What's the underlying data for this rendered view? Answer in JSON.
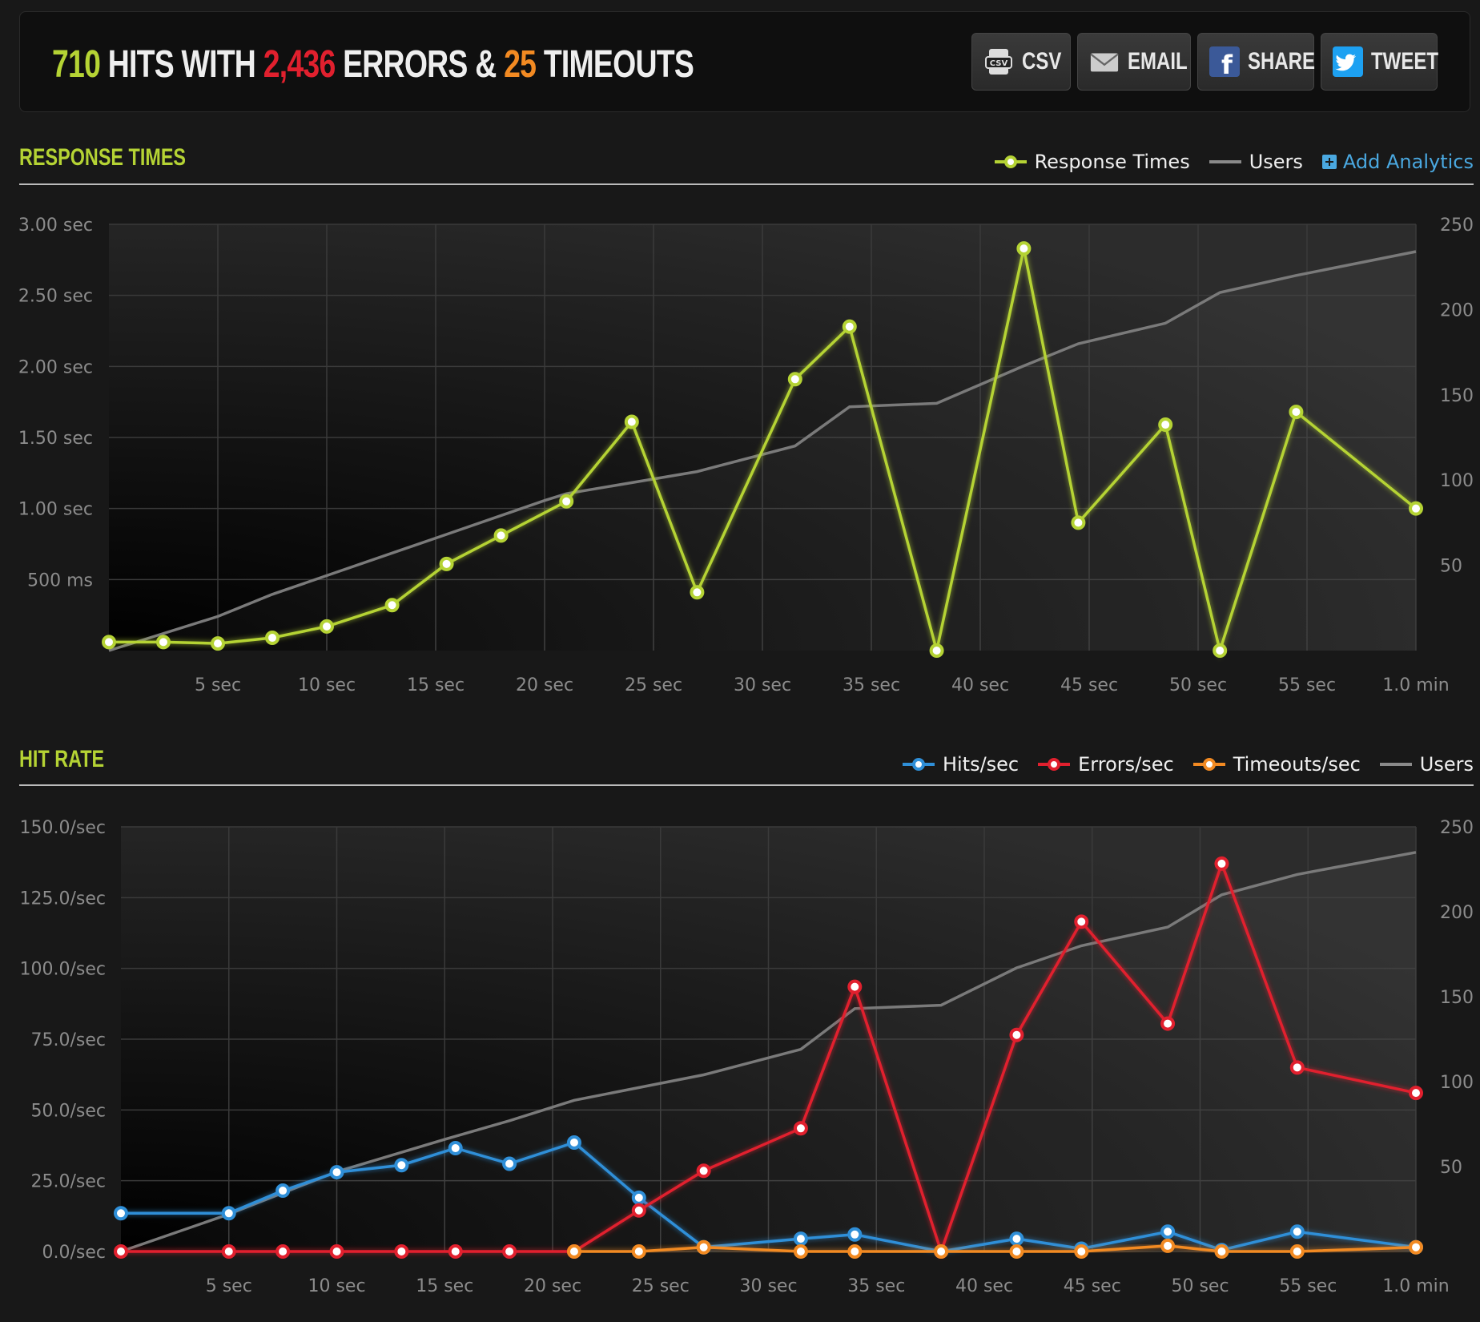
{
  "summary": {
    "hits_value": "710",
    "hits_text": " HITS WITH ",
    "errors_value": "2,436",
    "errors_text": " ERRORS & ",
    "timeouts_value": "25",
    "timeouts_text": " TIMEOUTS"
  },
  "buttons": {
    "csv": "CSV",
    "email": "EMAIL",
    "share": "SHARE",
    "tweet": "TWEET"
  },
  "response_section": {
    "title": "RESPONSE TIMES",
    "legend_response": "Response Times",
    "legend_users": "Users",
    "add_analytics": "Add Analytics"
  },
  "hitrate_section": {
    "title": "HIT RATE",
    "legend_hits": "Hits/sec",
    "legend_errors": "Errors/sec",
    "legend_timeouts": "Timeouts/sec",
    "legend_users": "Users"
  },
  "colors": {
    "response": "#b5d334",
    "users": "#7a7a7a",
    "hits": "#2f8fd8",
    "errors": "#e1202e",
    "timeouts": "#f28a22"
  },
  "chart_data": [
    {
      "type": "line",
      "title": "RESPONSE TIMES",
      "x_unit": "seconds",
      "xlim": [
        0,
        60
      ],
      "x_ticks": [
        5,
        10,
        15,
        20,
        25,
        30,
        35,
        40,
        45,
        50,
        55,
        60
      ],
      "x_tick_labels": [
        "5 sec",
        "10 sec",
        "15 sec",
        "20 sec",
        "25 sec",
        "30 sec",
        "35 sec",
        "40 sec",
        "45 sec",
        "50 sec",
        "55 sec",
        "1.0 min"
      ],
      "y_left_unit": "seconds",
      "ylim_left": [
        0,
        3.0
      ],
      "y_left_ticks": [
        0.5,
        1.0,
        1.5,
        2.0,
        2.5,
        3.0
      ],
      "y_left_tick_labels": [
        "500 ms",
        "1.00 sec",
        "1.50 sec",
        "2.00 sec",
        "2.50 sec",
        "3.00 sec"
      ],
      "ylim_right": [
        0,
        250
      ],
      "y_right_ticks": [
        50,
        100,
        150,
        200,
        250
      ],
      "y_right_tick_labels": [
        "50",
        "100",
        "150",
        "200",
        "250"
      ],
      "series": [
        {
          "name": "Response Times",
          "axis": "left",
          "color": "#b5d334",
          "markers": true,
          "x": [
            0,
            2.5,
            5,
            7.5,
            10,
            13,
            15.5,
            18,
            21,
            24,
            27,
            31.5,
            34,
            38,
            42,
            44.5,
            48.5,
            51,
            54.5,
            60
          ],
          "y": [
            0.06,
            0.06,
            0.05,
            0.09,
            0.17,
            0.32,
            0.61,
            0.81,
            1.05,
            1.61,
            0.41,
            1.91,
            2.28,
            0.0,
            2.83,
            0.9,
            1.59,
            0.0,
            1.68,
            1.0
          ]
        },
        {
          "name": "Users",
          "axis": "right",
          "color": "#7a7a7a",
          "markers": false,
          "x": [
            0,
            5,
            7.5,
            10,
            15,
            20,
            21,
            27,
            31.5,
            34,
            38,
            42,
            44.5,
            48.5,
            51,
            54.5,
            60
          ],
          "y": [
            0,
            20,
            33,
            44,
            66,
            88,
            92,
            105,
            120,
            143,
            145,
            167,
            180,
            192,
            210,
            220,
            234
          ]
        }
      ]
    },
    {
      "type": "line",
      "title": "HIT RATE",
      "x_unit": "seconds",
      "xlim": [
        0,
        60
      ],
      "x_ticks": [
        5,
        10,
        15,
        20,
        25,
        30,
        35,
        40,
        45,
        50,
        55,
        60
      ],
      "x_tick_labels": [
        "5 sec",
        "10 sec",
        "15 sec",
        "20 sec",
        "25 sec",
        "30 sec",
        "35 sec",
        "40 sec",
        "45 sec",
        "50 sec",
        "55 sec",
        "1.0 min"
      ],
      "y_left_unit": "per second",
      "ylim_left": [
        0,
        150
      ],
      "y_left_ticks": [
        0,
        25,
        50,
        75,
        100,
        125,
        150
      ],
      "y_left_tick_labels": [
        "0.0/sec",
        "25.0/sec",
        "50.0/sec",
        "75.0/sec",
        "100.0/sec",
        "125.0/sec",
        "150.0/sec"
      ],
      "ylim_right": [
        0,
        250
      ],
      "y_right_ticks": [
        50,
        100,
        150,
        200,
        250
      ],
      "y_right_tick_labels": [
        "50",
        "100",
        "150",
        "200",
        "250"
      ],
      "series": [
        {
          "name": "Hits/sec",
          "axis": "left",
          "color": "#2f8fd8",
          "markers": true,
          "x": [
            0,
            5,
            7.5,
            10,
            13,
            15.5,
            18,
            21,
            24,
            27,
            31.5,
            34,
            38,
            41.5,
            44.5,
            48.5,
            51,
            54.5,
            60
          ],
          "y": [
            13.5,
            13.5,
            21.5,
            28,
            30.5,
            36.5,
            31,
            38.5,
            19,
            1.5,
            4.5,
            6,
            0,
            4.5,
            1,
            7,
            0.5,
            7,
            1.5
          ]
        },
        {
          "name": "Errors/sec",
          "axis": "left",
          "color": "#e1202e",
          "markers": true,
          "x": [
            0,
            5,
            7.5,
            10,
            13,
            15.5,
            18,
            21,
            24,
            27,
            31.5,
            34,
            38,
            41.5,
            44.5,
            48.5,
            51,
            54.5,
            60
          ],
          "y": [
            0,
            0,
            0,
            0,
            0,
            0,
            0,
            0,
            14.5,
            28.5,
            43.5,
            93.5,
            0,
            76.5,
            116.5,
            80.5,
            137,
            65,
            56
          ]
        },
        {
          "name": "Timeouts/sec",
          "axis": "left",
          "color": "#f28a22",
          "markers": true,
          "x": [
            21,
            24,
            27,
            31.5,
            34,
            38,
            41.5,
            44.5,
            48.5,
            51,
            54.5,
            60
          ],
          "y": [
            0,
            0,
            1.5,
            0,
            0,
            0,
            0,
            0,
            2,
            0,
            0,
            1.5
          ]
        },
        {
          "name": "Users",
          "axis": "right",
          "color": "#7a7a7a",
          "markers": false,
          "x": [
            0,
            5,
            10,
            15,
            18,
            21,
            27,
            31.5,
            34,
            38,
            41.5,
            44.5,
            48.5,
            51,
            54.5,
            60
          ],
          "y": [
            0,
            22,
            47,
            66,
            77,
            89,
            104,
            119,
            143,
            145,
            167,
            180,
            191,
            210,
            222,
            235
          ]
        }
      ]
    }
  ]
}
